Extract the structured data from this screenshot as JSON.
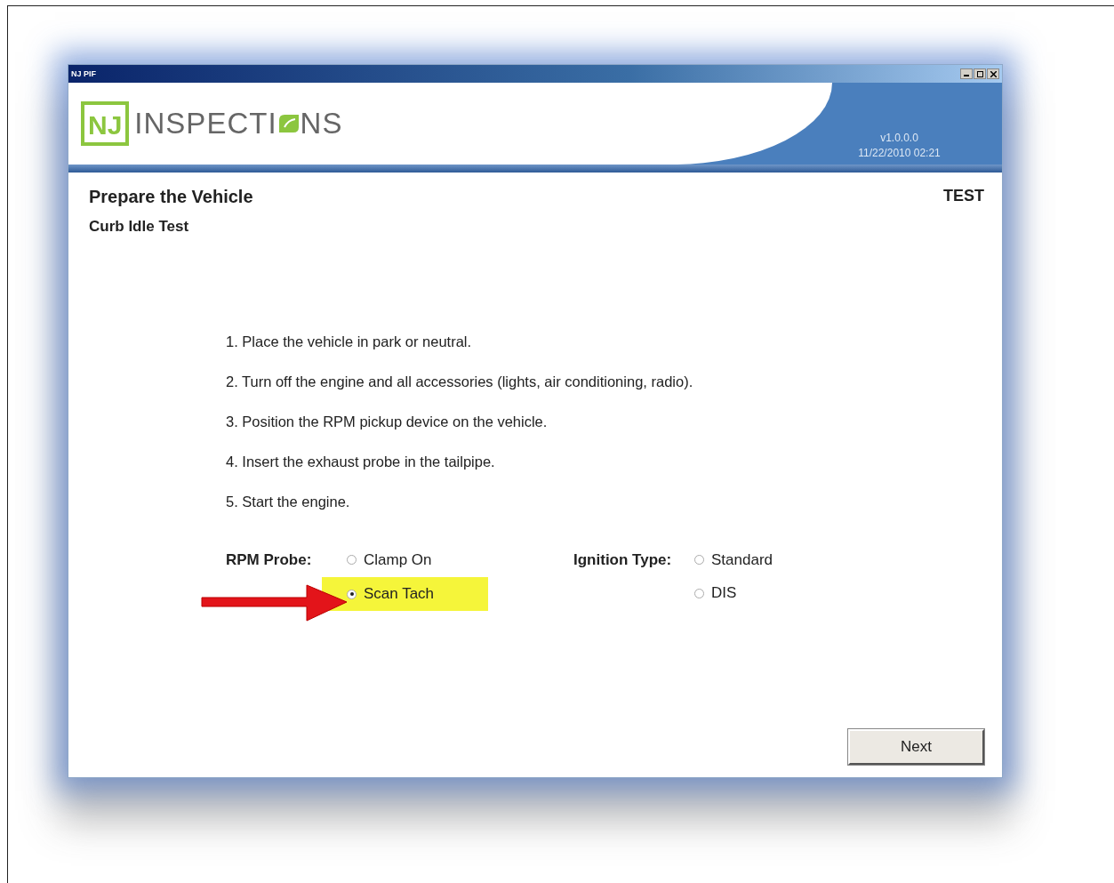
{
  "window": {
    "title": "NJ PIF"
  },
  "logo": {
    "badge": "NJ",
    "text_before": "INSPECTI",
    "text_after": "NS"
  },
  "header": {
    "version": "v1.0.0.0",
    "timestamp": "11/22/2010 02:21"
  },
  "page": {
    "title": "Prepare the Vehicle",
    "subtitle": "Curb Idle Test",
    "mode": "TEST"
  },
  "steps": [
    "1. Place the vehicle in park or neutral.",
    "2. Turn off the engine and all accessories (lights, air conditioning, radio).",
    "3. Position the RPM pickup device on the vehicle.",
    "4. Insert the exhaust probe in the tailpipe.",
    "5. Start the engine."
  ],
  "option_groups": [
    {
      "label": "RPM Probe:",
      "options": [
        {
          "label": "Clamp On",
          "selected": false,
          "highlighted": false
        },
        {
          "label": "Scan Tach",
          "selected": true,
          "highlighted": true
        }
      ]
    },
    {
      "label": "Ignition Type:",
      "options": [
        {
          "label": "Standard",
          "selected": false,
          "highlighted": false
        },
        {
          "label": "DIS",
          "selected": false,
          "highlighted": false
        }
      ]
    }
  ],
  "buttons": [
    "Next"
  ]
}
